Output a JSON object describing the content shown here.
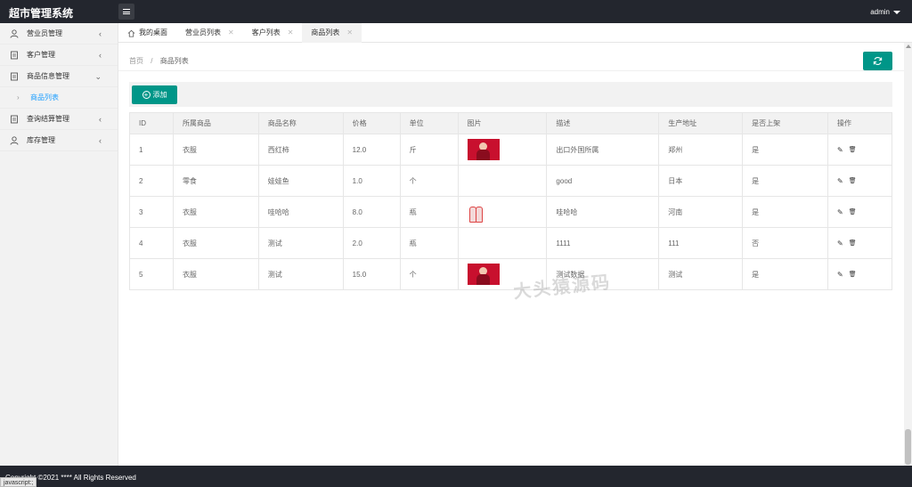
{
  "header": {
    "brand": "超市管理系统",
    "user": "admin"
  },
  "sidebar": {
    "items": [
      {
        "label": "营业员管理",
        "icon": "user-icon"
      },
      {
        "label": "客户管理",
        "icon": "document-icon"
      },
      {
        "label": "商品信息管理",
        "icon": "document-icon",
        "open": true
      },
      {
        "label": "查询结算管理",
        "icon": "document-icon"
      },
      {
        "label": "库存管理",
        "icon": "user-icon"
      }
    ],
    "sub_item": "商品列表"
  },
  "tabs": [
    {
      "label": "我的桌面",
      "icon": "home-icon"
    },
    {
      "label": "营业员列表"
    },
    {
      "label": "客户列表"
    },
    {
      "label": "商品列表",
      "active": true
    }
  ],
  "breadcrumb": {
    "home": "首页",
    "sep": "/",
    "current": "商品列表"
  },
  "toolbar": {
    "add_label": "添加"
  },
  "table": {
    "headers": [
      "ID",
      "所属商品",
      "商品名称",
      "价格",
      "单位",
      "图片",
      "描述",
      "生产地址",
      "是否上架",
      "操作"
    ],
    "rows": [
      [
        "1",
        "衣服",
        "西红柿",
        "12.0",
        "斤",
        "red",
        "出口外国所属",
        "郑州",
        "是"
      ],
      [
        "2",
        "零食",
        "娃娃鱼",
        "1.0",
        "个",
        "",
        "good",
        "日本",
        "是"
      ],
      [
        "3",
        "衣服",
        "哇哈哈",
        "8.0",
        "瓶",
        "bottle",
        "哇哈哈",
        "河南",
        "是"
      ],
      [
        "4",
        "衣服",
        "测试",
        "2.0",
        "瓶",
        "",
        "1111",
        "111",
        "否"
      ],
      [
        "5",
        "衣服",
        "测试",
        "15.0",
        "个",
        "red",
        "测试数据",
        "测试",
        "是"
      ]
    ]
  },
  "watermark": "大头猿源码",
  "footer": {
    "copyright": "Copyright ©2021 **** All Rights Reserved"
  },
  "status_bar": "javascript:;",
  "colors": {
    "accent": "#009688",
    "header": "#23262e",
    "link": "#1e9fff"
  }
}
